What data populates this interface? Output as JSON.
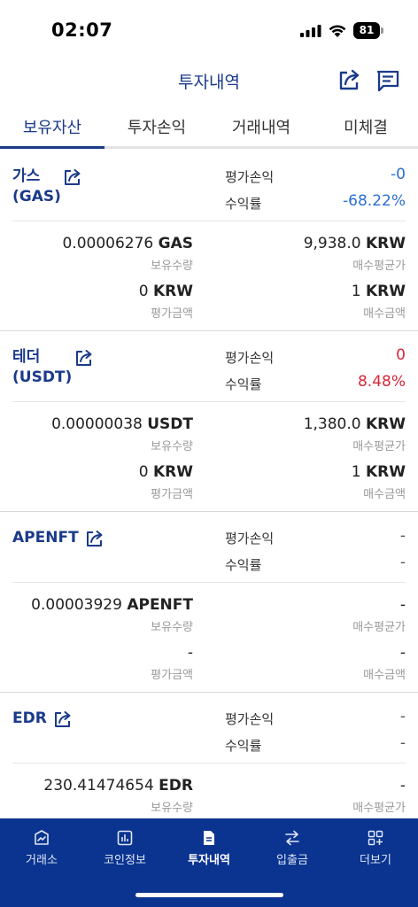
{
  "status_bar": {
    "time": "02:07",
    "battery": "81"
  },
  "header": {
    "title": "투자내역",
    "share_icon": "share-icon",
    "message_icon": "message-icon"
  },
  "tabs": [
    {
      "label": "보유자산",
      "active": true
    },
    {
      "label": "투자손익",
      "active": false
    },
    {
      "label": "거래내역",
      "active": false
    },
    {
      "label": "미체결",
      "active": false
    }
  ],
  "labels": {
    "eval_pnl": "평가손익",
    "return_rate": "수익률",
    "holding_qty": "보유수량",
    "avg_buy_price": "매수평균가",
    "eval_amount": "평가금액",
    "buy_amount": "매수금액"
  },
  "coins": [
    {
      "name_line1": "가스",
      "name_line2": "(GAS)",
      "eval_pnl": "-0",
      "return_rate": "-68.22%",
      "color": "#2b6fd4",
      "qty_value": "0.00006276 ",
      "qty_unit": "GAS",
      "avg_value": "9,938.0 ",
      "avg_unit": "KRW",
      "eval_value": "0 ",
      "eval_unit": "KRW",
      "buy_value": "1 ",
      "buy_unit": "KRW"
    },
    {
      "name_line1": "테더",
      "name_line2": "(USDT)",
      "eval_pnl": "0",
      "return_rate": "8.48%",
      "color": "#d9263a",
      "qty_value": "0.00000038 ",
      "qty_unit": "USDT",
      "avg_value": "1,380.0 ",
      "avg_unit": "KRW",
      "eval_value": "0 ",
      "eval_unit": "KRW",
      "buy_value": "1 ",
      "buy_unit": "KRW"
    },
    {
      "name_line1": "APENFT",
      "eval_pnl": "-",
      "return_rate": "-",
      "qty_value": "0.00003929 ",
      "qty_unit": "APENFT",
      "avg_dash": "-",
      "eval_dash": "-",
      "buy_dash": "-"
    },
    {
      "name_line1": "EDR",
      "eval_pnl": "-",
      "return_rate": "-",
      "qty_value": "230.41474654 ",
      "qty_unit": "EDR",
      "avg_dash": "-"
    }
  ],
  "bottom_nav": [
    {
      "label": "거래소",
      "icon": "exchange-icon",
      "active": false
    },
    {
      "label": "코인정보",
      "icon": "chart-icon",
      "active": false
    },
    {
      "label": "투자내역",
      "icon": "document-icon",
      "active": true
    },
    {
      "label": "입출금",
      "icon": "transfer-icon",
      "active": false
    },
    {
      "label": "더보기",
      "icon": "more-icon",
      "active": false
    }
  ]
}
